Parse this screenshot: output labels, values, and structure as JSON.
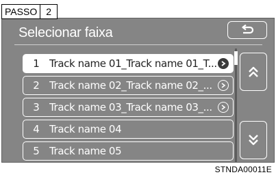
{
  "step": {
    "label": "PASSO",
    "number": "2"
  },
  "title": "Selecionar faixa",
  "back_icon": "back-arrow-icon",
  "tracks": [
    {
      "num": "1",
      "name": "Track name 01_Track name 01_T...",
      "selected": true,
      "icon": "chevron-right-icon"
    },
    {
      "num": "2",
      "name": "Track name 02_Track name 02_...",
      "selected": false,
      "icon": "chevron-right-icon"
    },
    {
      "num": "3",
      "name": "Track name 03_Track name 03_...",
      "selected": false,
      "icon": "chevron-right-icon"
    },
    {
      "num": "4",
      "name": "Track name 04",
      "selected": false,
      "icon": ""
    },
    {
      "num": "5",
      "name": "Track name 05",
      "selected": false,
      "icon": ""
    }
  ],
  "scroll_up_icon": "double-chevron-up-icon",
  "scroll_down_icon": "double-chevron-down-icon",
  "caption": "STNDA00011E",
  "colors": {
    "screen_bg": "#858585",
    "accent": "#ffffff"
  }
}
